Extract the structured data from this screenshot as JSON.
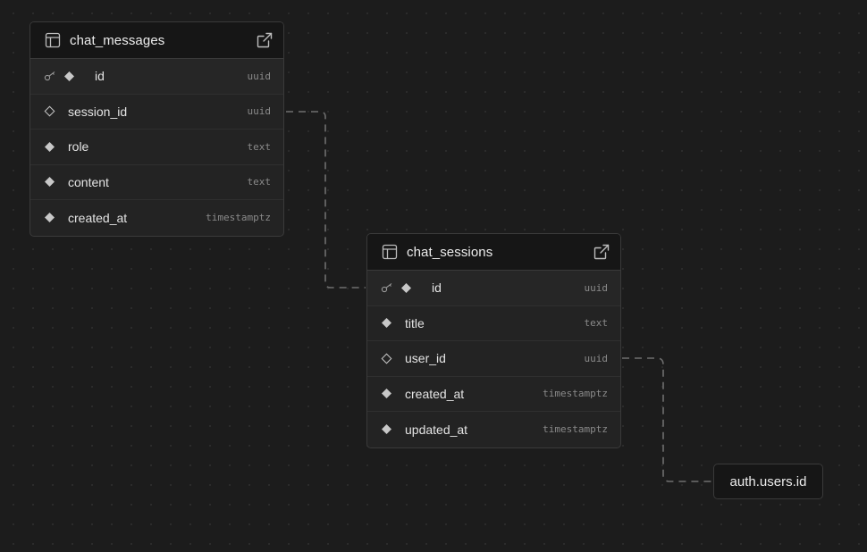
{
  "tables": [
    {
      "id": "chat_messages",
      "name": "chat_messages",
      "icon": "table-icon",
      "open_icon": "external-link-icon",
      "columns": [
        {
          "name": "id",
          "type": "uuid",
          "primary_key": true,
          "nullable": false
        },
        {
          "name": "session_id",
          "type": "uuid",
          "primary_key": false,
          "nullable": true
        },
        {
          "name": "role",
          "type": "text",
          "primary_key": false,
          "nullable": false
        },
        {
          "name": "content",
          "type": "text",
          "primary_key": false,
          "nullable": false
        },
        {
          "name": "created_at",
          "type": "timestamptz",
          "primary_key": false,
          "nullable": false
        }
      ]
    },
    {
      "id": "chat_sessions",
      "name": "chat_sessions",
      "icon": "table-icon",
      "open_icon": "external-link-icon",
      "columns": [
        {
          "name": "id",
          "type": "uuid",
          "primary_key": true,
          "nullable": false
        },
        {
          "name": "title",
          "type": "text",
          "primary_key": false,
          "nullable": false
        },
        {
          "name": "user_id",
          "type": "uuid",
          "primary_key": false,
          "nullable": true
        },
        {
          "name": "created_at",
          "type": "timestamptz",
          "primary_key": false,
          "nullable": false
        },
        {
          "name": "updated_at",
          "type": "timestamptz",
          "primary_key": false,
          "nullable": false
        }
      ]
    }
  ],
  "external_refs": [
    {
      "label": "auth.users.id"
    }
  ],
  "relations": [
    {
      "from": "chat_messages.session_id",
      "to": "chat_sessions.id"
    },
    {
      "from": "chat_sessions.user_id",
      "to": "auth.users.id"
    }
  ],
  "colors": {
    "canvas": "#1c1c1c",
    "node_body": "#232323",
    "node_header": "#161616",
    "border": "#3a3a3a",
    "text": "#ededed",
    "type_text": "#8a8a8a",
    "edge": "#6e6e6e"
  }
}
